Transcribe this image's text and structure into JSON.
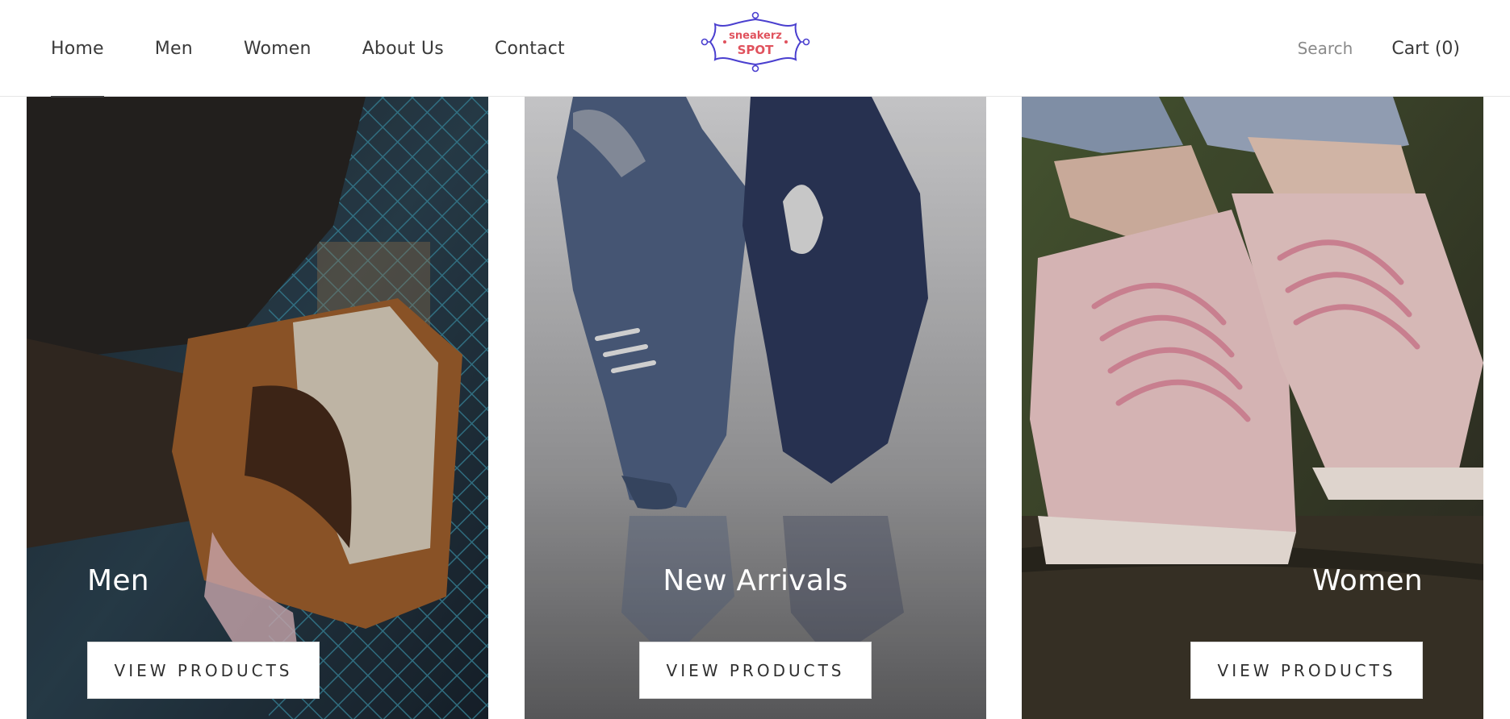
{
  "nav": {
    "items": [
      {
        "label": "Home",
        "active": true
      },
      {
        "label": "Men",
        "active": false
      },
      {
        "label": "Women",
        "active": false
      },
      {
        "label": "About Us",
        "active": false
      },
      {
        "label": "Contact",
        "active": false
      }
    ]
  },
  "logo": {
    "line1": "sneakerz",
    "line2": "SPOT",
    "colors": {
      "frame": "#4a3fcf",
      "text": "#e0525d"
    }
  },
  "header": {
    "search_label": "Search",
    "cart_label": "Cart (0)"
  },
  "collections": [
    {
      "title": "Men",
      "button_label": "VIEW PRODUCTS",
      "image": "sneaker-chainlink-fence-photo"
    },
    {
      "title": "New Arrivals",
      "button_label": "VIEW PRODUCTS",
      "image": "blue-sneakers-reflection-photo"
    },
    {
      "title": "Women",
      "button_label": "VIEW PRODUCTS",
      "image": "pink-sneakers-on-log-photo"
    }
  ]
}
